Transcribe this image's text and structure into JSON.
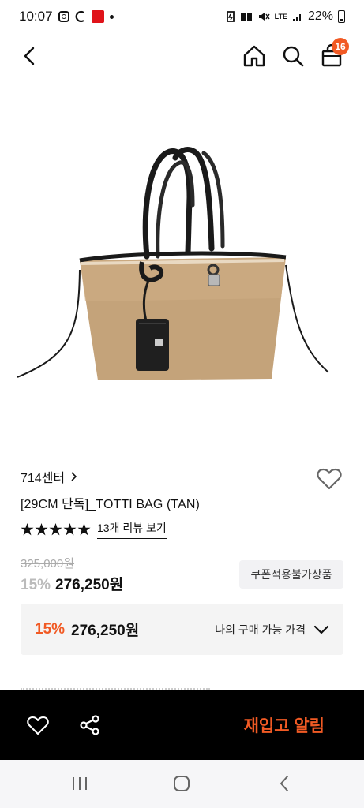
{
  "status_bar": {
    "time": "10:07",
    "network": "LTE",
    "battery": "22%"
  },
  "header": {
    "cart_count": "16",
    "icons": [
      "back-arrow-icon",
      "home-icon",
      "search-icon",
      "shopping-bag-icon"
    ]
  },
  "product": {
    "brand": "714센터",
    "name": "[29CM 단독]_TOTTI BAG (TAN)",
    "rating_stars": 5,
    "review_link": "13개 리뷰 보기",
    "original_price": "325,000원",
    "discount_pct": "15%",
    "sale_price": "276,250원",
    "coupon_badge": "쿠폰적용불가상품"
  },
  "my_price": {
    "discount_pct": "15%",
    "price": "276,250원",
    "label": "나의 구매 가능 가격"
  },
  "action_bar": {
    "restock_label": "재입고 알림"
  },
  "colors": {
    "accent": "#f15a24",
    "bar_bg": "#000000"
  }
}
